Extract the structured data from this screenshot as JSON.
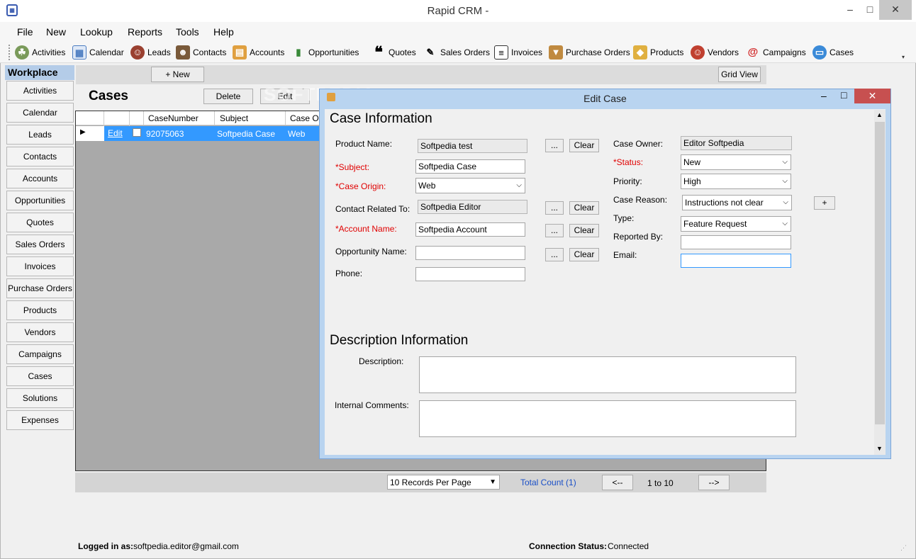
{
  "window": {
    "title": "Rapid CRM -",
    "min": "–",
    "max": "□",
    "close": "✕"
  },
  "menu": [
    "File",
    "New",
    "Lookup",
    "Reports",
    "Tools",
    "Help"
  ],
  "toolbar": [
    "Activities",
    "Calendar",
    "Leads",
    "Contacts",
    "Accounts",
    "Opportunities",
    "Quotes",
    "Sales Orders",
    "Invoices",
    "Purchase Orders",
    "Products",
    "Vendors",
    "Campaigns",
    "Cases"
  ],
  "sidebar": {
    "title": "Workplace",
    "items": [
      "Activities",
      "Calendar",
      "Leads",
      "Contacts",
      "Accounts",
      "Opportunities",
      "Quotes",
      "Sales Orders",
      "Invoices",
      "Purchase Orders",
      "Products",
      "Vendors",
      "Campaigns",
      "Cases",
      "Solutions",
      "Expenses"
    ]
  },
  "main": {
    "new_label": "+ New",
    "grid_view_label": "Grid View",
    "title": "Cases",
    "delete_label": "Delete",
    "edit_label": "Edit",
    "watermark": "SOFTPEDIA",
    "columns": [
      "CaseNumber",
      "Subject",
      "Case Ori"
    ],
    "row": {
      "edit": "Edit",
      "case_number": "92075063",
      "subject": "Softpedia Case",
      "origin": "Web"
    }
  },
  "pager": {
    "per_page": "10 Records Per Page",
    "total": "Total Count (1)",
    "prev": "<--",
    "range": "1 to 10",
    "next": "-->"
  },
  "status": {
    "logged_label": "Logged in as:",
    "user": "softpedia.editor@gmail.com",
    "conn_label": "Connection Status:",
    "conn_value": "Connected"
  },
  "modal": {
    "title": "Edit Case",
    "case_info": "Case Information",
    "desc_info": "Description Information",
    "browse": "...",
    "clear": "Clear",
    "plus": "+",
    "fields": {
      "product_name": {
        "label": "Product Name:",
        "value": "Softpedia test"
      },
      "subject": {
        "label": "*Subject:",
        "value": "Softpedia Case"
      },
      "case_origin": {
        "label": "*Case Origin:",
        "value": "Web"
      },
      "contact": {
        "label": "Contact Related To:",
        "value": "Softpedia Editor"
      },
      "account": {
        "label": "*Account Name:",
        "value": "Softpedia Account"
      },
      "opportunity": {
        "label": "Opportunity Name:",
        "value": ""
      },
      "phone": {
        "label": "Phone:",
        "value": ""
      },
      "case_owner": {
        "label": "Case Owner:",
        "value": "Editor Softpedia"
      },
      "status": {
        "label": "*Status:",
        "value": "New"
      },
      "priority": {
        "label": "Priority:",
        "value": "High"
      },
      "case_reason": {
        "label": "Case Reason:",
        "value": "Instructions not clear"
      },
      "type": {
        "label": "Type:",
        "value": "Feature Request"
      },
      "reported_by": {
        "label": "Reported By:",
        "value": ""
      },
      "email": {
        "label": "Email:",
        "value": ""
      },
      "description": {
        "label": "Description:",
        "value": ""
      },
      "internal_comments": {
        "label": "Internal Comments:",
        "value": ""
      }
    }
  },
  "colors": {
    "accent": "#3399ff",
    "required": "#e00000",
    "modal_frame": "#b9d4f0",
    "close": "#c75050"
  }
}
